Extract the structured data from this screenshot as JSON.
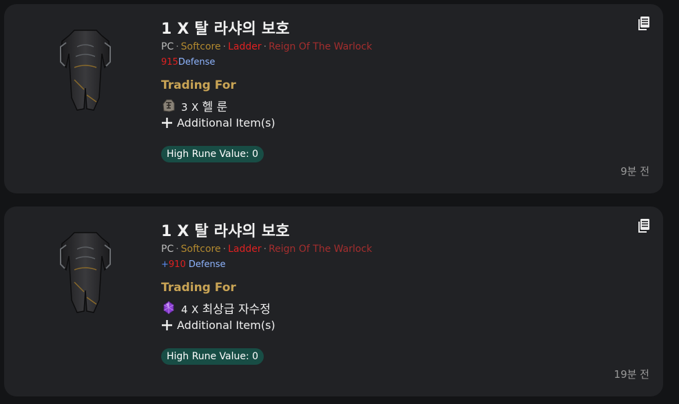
{
  "listings": [
    {
      "title": "1 X 탈 라샤의 보호",
      "meta": {
        "platform": "PC",
        "mode": "Softcore",
        "ladder": "Ladder",
        "season": "Reign Of The Warlock"
      },
      "defense": {
        "prefix": "",
        "value": "915",
        "label": "Defense"
      },
      "trading_for_label": "Trading For",
      "trade_item": {
        "quantity": "3",
        "times": "X",
        "name": "헬 룬",
        "icon": "hel-rune-icon"
      },
      "additional_label": "Additional Item(s)",
      "high_rune_value": "High Rune Value: 0",
      "timestamp": "9분 전"
    },
    {
      "title": "1 X 탈 라샤의 보호",
      "meta": {
        "platform": "PC",
        "mode": "Softcore",
        "ladder": "Ladder",
        "season": "Reign Of The Warlock"
      },
      "defense": {
        "prefix": "+",
        "value": "910",
        "label": "Defense"
      },
      "trading_for_label": "Trading For",
      "trade_item": {
        "quantity": "4",
        "times": "X",
        "name": "최상급 자수정",
        "icon": "amethyst-gem-icon"
      },
      "additional_label": "Additional Item(s)",
      "high_rune_value": "High Rune Value: 0",
      "timestamp": "19분 전"
    }
  ],
  "colors": {
    "background": "#131416",
    "card": "#212225",
    "softcore": "#b2892f",
    "ladder": "#e02121",
    "season": "#a52e2e",
    "trading_for": "#c9a455",
    "badge": "#184d45",
    "defense_label": "#8fb5ff"
  }
}
